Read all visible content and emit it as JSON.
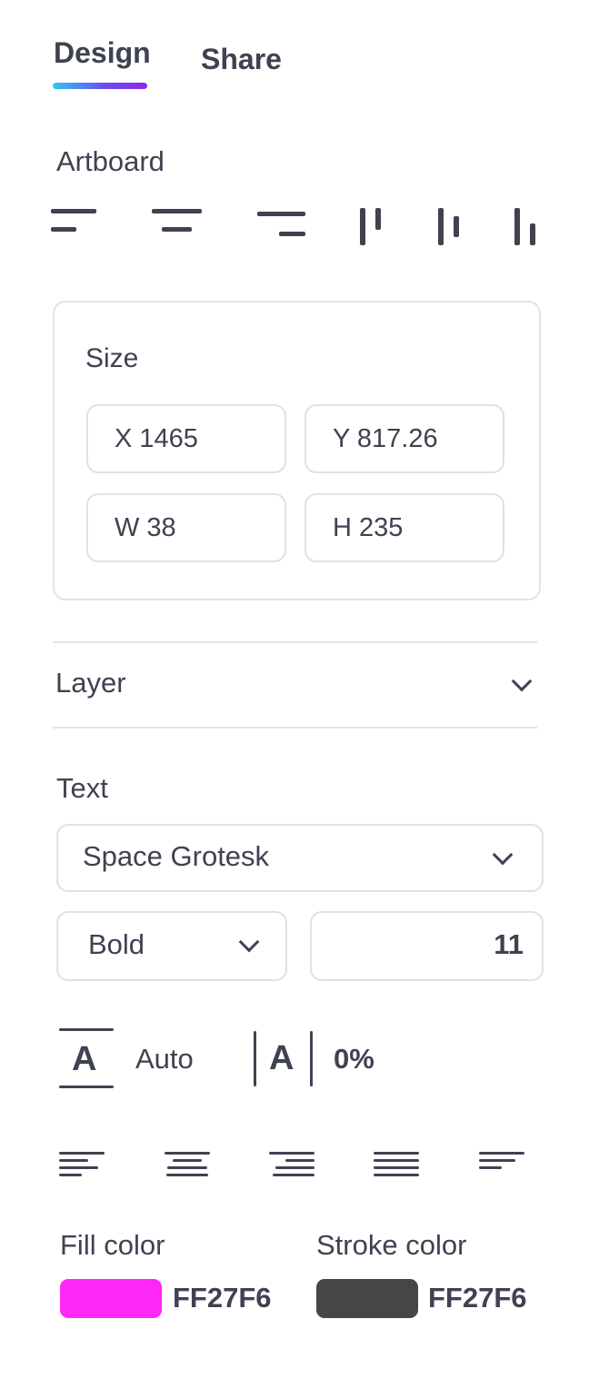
{
  "tabs": [
    {
      "label": "Design",
      "active": true
    },
    {
      "label": "Share",
      "active": false
    }
  ],
  "artboard": {
    "title": "Artboard",
    "align_icons": [
      "align-left-icon",
      "align-center-horizontal-icon",
      "align-right-icon",
      "align-top-icon",
      "align-middle-vertical-icon",
      "align-bottom-icon"
    ]
  },
  "size": {
    "title": "Size",
    "x": "X 1465",
    "y": "Y 817.26",
    "w": "W 38",
    "h": "H 235"
  },
  "layer": {
    "title": "Layer"
  },
  "text": {
    "title": "Text",
    "font_family": "Space Grotesk",
    "font_weight": "Bold",
    "font_size": "11",
    "line_height": "Auto",
    "letter_spacing": "0%",
    "align_icons": [
      "text-align-left-icon",
      "text-align-center-icon",
      "text-align-right-icon",
      "text-align-justify-icon",
      "text-align-left-short-icon"
    ]
  },
  "colors": {
    "fill_label": "Fill color",
    "fill_value": "FF27F6",
    "fill_swatch": "#ff27f6",
    "stroke_label": "Stroke color",
    "stroke_value": "FF27F6",
    "stroke_swatch": "#464646"
  }
}
